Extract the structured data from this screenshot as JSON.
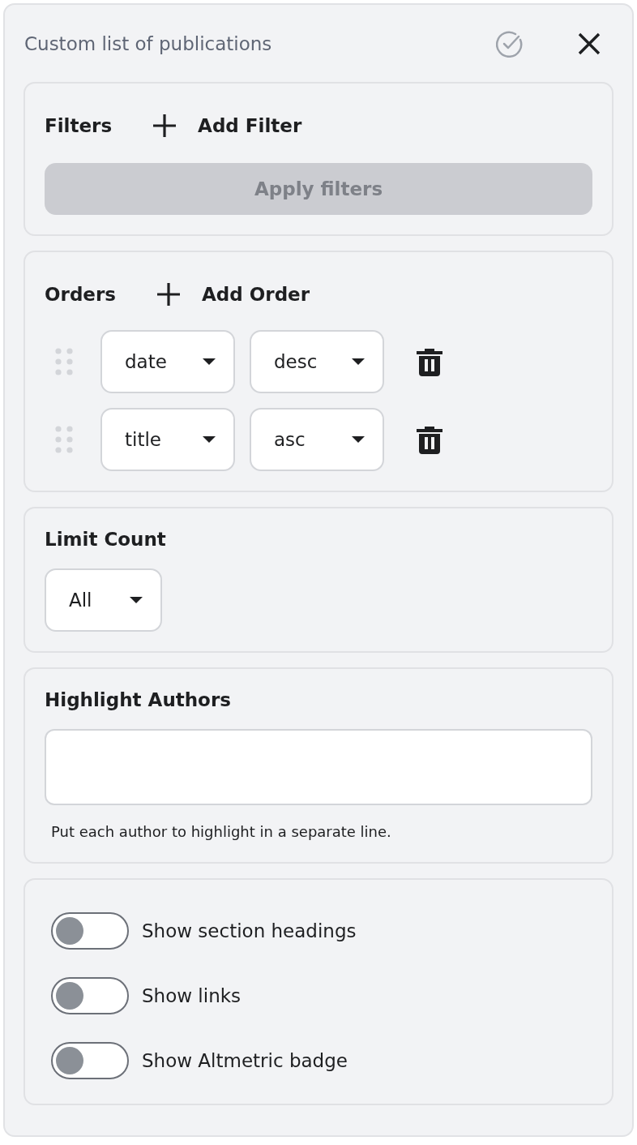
{
  "window": {
    "title": "Custom list of publications"
  },
  "filters": {
    "heading": "Filters",
    "add_label": "Add Filter",
    "apply_button": {
      "label": "Apply filters",
      "disabled": true
    }
  },
  "orders": {
    "heading": "Orders",
    "add_label": "Add Order",
    "rows": [
      {
        "field": "date",
        "direction": "desc"
      },
      {
        "field": "title",
        "direction": "asc"
      }
    ]
  },
  "limit": {
    "heading": "Limit Count",
    "value": "All"
  },
  "highlight": {
    "heading": "Highlight Authors",
    "hint": "Put each author to highlight in a separate line."
  },
  "toggles": [
    {
      "label": "Show section headings",
      "on": false
    },
    {
      "label": "Show links",
      "on": false
    },
    {
      "label": "Show Altmetric badge",
      "on": false
    }
  ]
}
